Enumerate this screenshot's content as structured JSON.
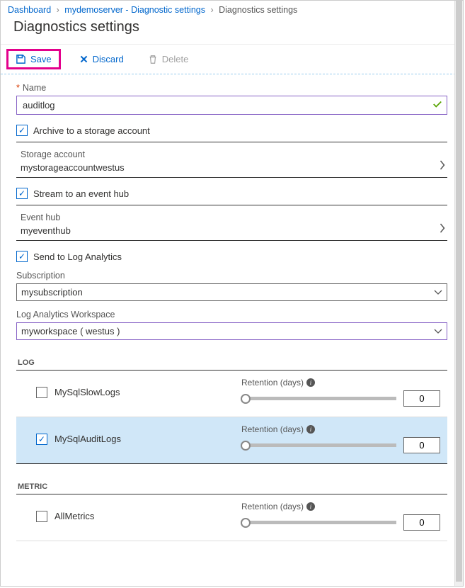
{
  "breadcrumb": {
    "dashboard": "Dashboard",
    "item2": "mydemoserver - Diagnostic settings",
    "current": "Diagnostics settings"
  },
  "page_title": "Diagnostics settings",
  "toolbar": {
    "save": "Save",
    "discard": "Discard",
    "delete": "Delete"
  },
  "form": {
    "name_label": "Name",
    "name_value": "auditlog",
    "archive_label": "Archive to a storage account",
    "archive_checked": true,
    "storage_label": "Storage account",
    "storage_value": "mystorageaccountwestus",
    "stream_label": "Stream to an event hub",
    "stream_checked": true,
    "eventhub_label": "Event hub",
    "eventhub_value": "myeventhub",
    "sendla_label": "Send to Log Analytics",
    "sendla_checked": true,
    "subscription_label": "Subscription",
    "subscription_value": "mysubscription",
    "workspace_label": "Log Analytics Workspace",
    "workspace_value": "myworkspace ( westus )"
  },
  "sections": {
    "log": "LOG",
    "metric": "METRIC",
    "retention_label": "Retention (days)"
  },
  "log_items": [
    {
      "name": "MySqlSlowLogs",
      "checked": false,
      "retention": "0",
      "selected": false
    },
    {
      "name": "MySqlAuditLogs",
      "checked": true,
      "retention": "0",
      "selected": true
    }
  ],
  "metric_items": [
    {
      "name": "AllMetrics",
      "checked": false,
      "retention": "0",
      "selected": false
    }
  ]
}
